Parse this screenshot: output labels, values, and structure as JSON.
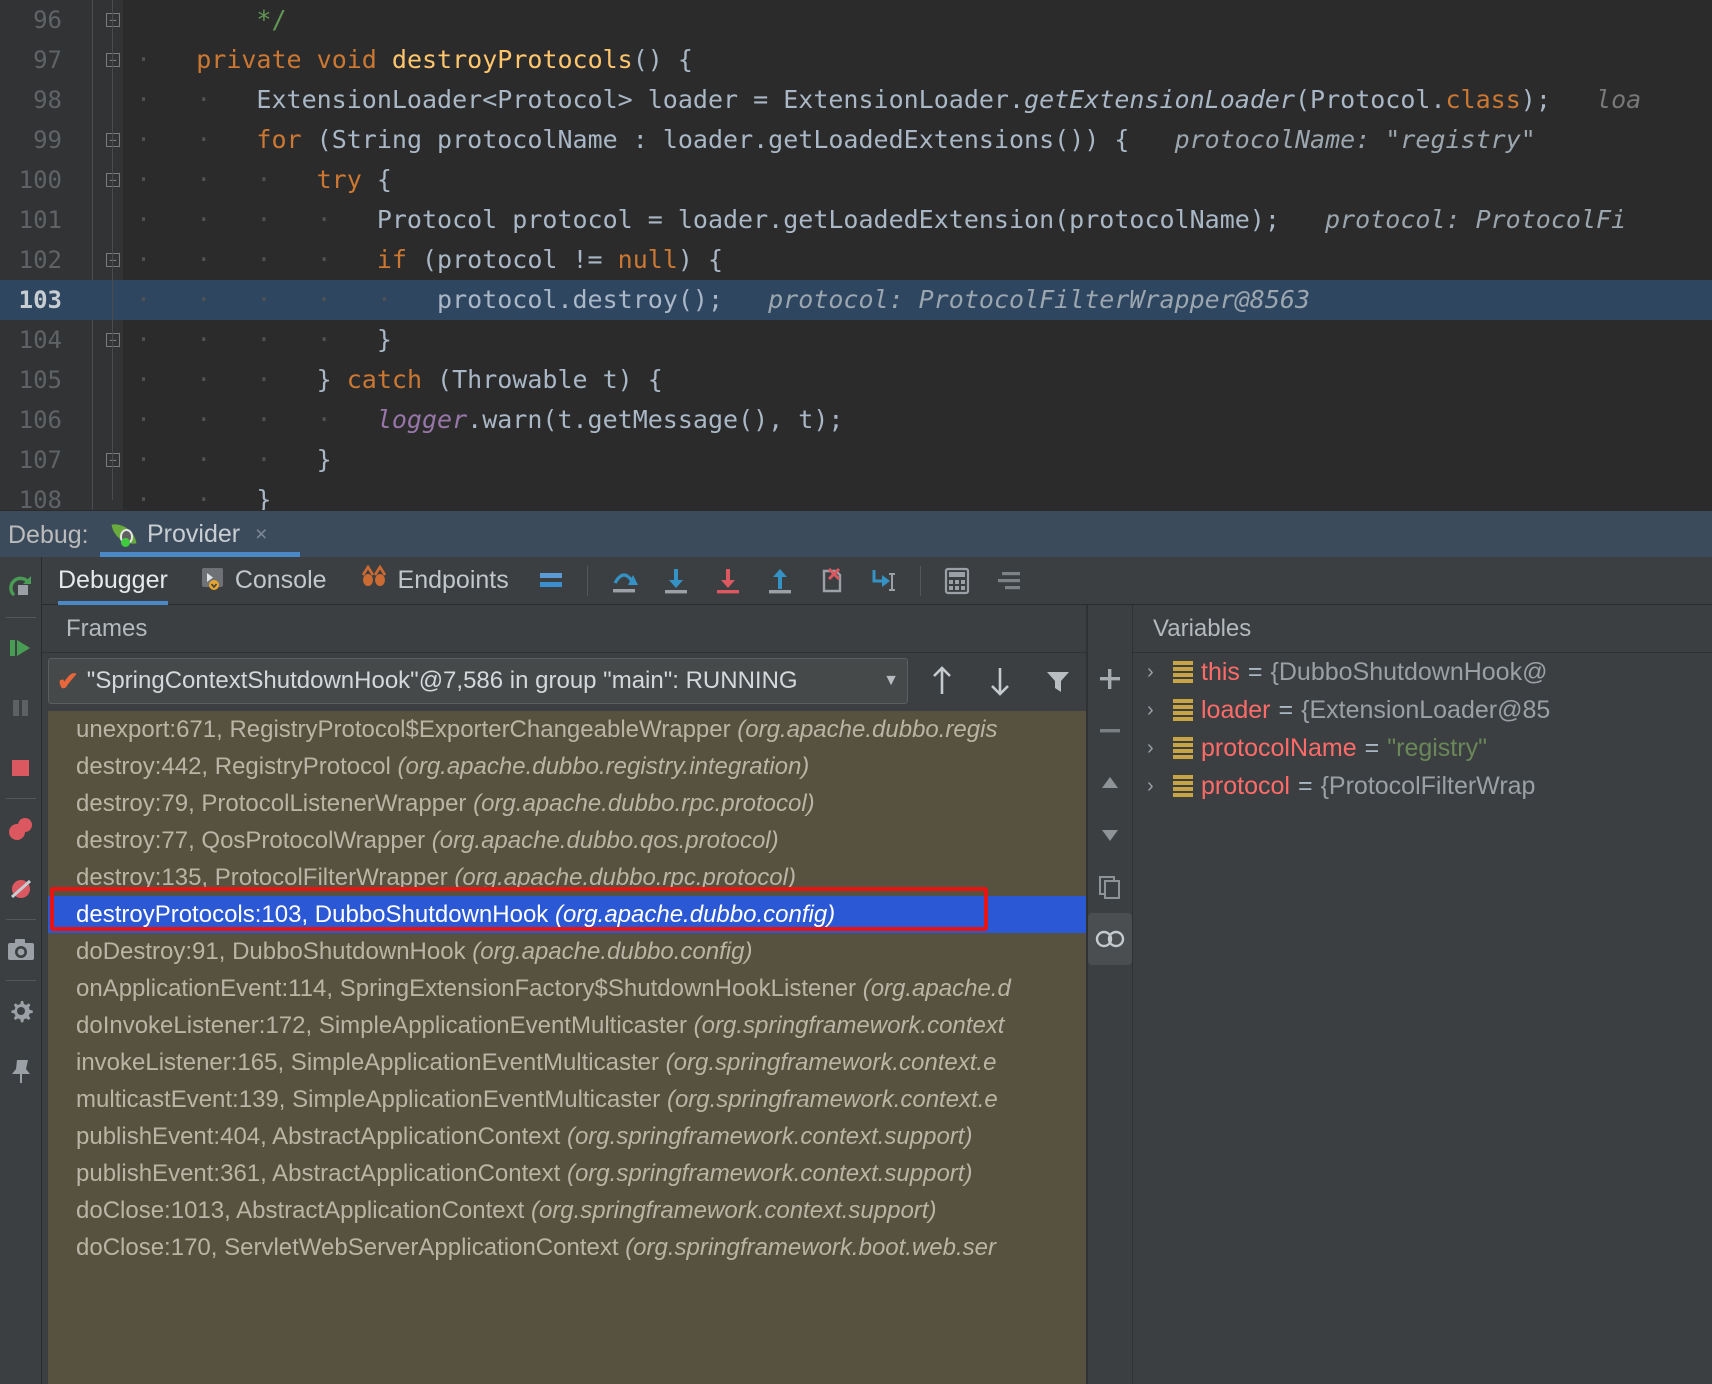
{
  "editor": {
    "lines": [
      {
        "num": "96",
        "segments": [
          {
            "t": "        */",
            "c": "cmt"
          }
        ]
      },
      {
        "num": "97",
        "segments": [
          {
            "t": "    ",
            "c": "dot"
          },
          {
            "t": "private ",
            "c": "kw"
          },
          {
            "t": "void ",
            "c": "kw"
          },
          {
            "t": "destroyProtocols",
            "c": "meth"
          },
          {
            "t": "() {",
            "c": "plain"
          }
        ]
      },
      {
        "num": "98",
        "segments": [
          {
            "t": "        ",
            "c": "dot"
          },
          {
            "t": "ExtensionLoader<Protocol> loader = ExtensionLoader.",
            "c": "plain"
          },
          {
            "t": "getExtensionLoader",
            "c": "ital"
          },
          {
            "t": "(Protocol.",
            "c": "plain"
          },
          {
            "t": "class",
            "c": "kw"
          },
          {
            "t": ");",
            "c": "plain"
          },
          {
            "t": "   loa",
            "c": "hint"
          }
        ]
      },
      {
        "num": "99",
        "segments": [
          {
            "t": "        ",
            "c": "dot"
          },
          {
            "t": "for ",
            "c": "kw"
          },
          {
            "t": "(String protocolName : loader.getLoadedExtensions()) {",
            "c": "plain"
          },
          {
            "t": "   protocolName: \"registry\"",
            "c": "hint2"
          }
        ]
      },
      {
        "num": "100",
        "segments": [
          {
            "t": "            ",
            "c": "dot"
          },
          {
            "t": "try ",
            "c": "kw"
          },
          {
            "t": "{",
            "c": "plain"
          }
        ]
      },
      {
        "num": "101",
        "segments": [
          {
            "t": "                ",
            "c": "dot"
          },
          {
            "t": "Protocol protocol = loader.getLoadedExtension(protocolName);",
            "c": "plain"
          },
          {
            "t": "   protocol: ProtocolFi",
            "c": "hint2"
          }
        ]
      },
      {
        "num": "102",
        "segments": [
          {
            "t": "                ",
            "c": "dot"
          },
          {
            "t": "if ",
            "c": "kw"
          },
          {
            "t": "(protocol != ",
            "c": "plain"
          },
          {
            "t": "null",
            "c": "kw"
          },
          {
            "t": ") {",
            "c": "plain"
          }
        ]
      },
      {
        "num": "103",
        "current": true,
        "segments": [
          {
            "t": "                    ",
            "c": "dot"
          },
          {
            "t": "protocol.destroy();",
            "c": "plain"
          },
          {
            "t": "   protocol: ProtocolFilterWrapper@8563",
            "c": "hint2"
          }
        ]
      },
      {
        "num": "104",
        "segments": [
          {
            "t": "                ",
            "c": "dot"
          },
          {
            "t": "}",
            "c": "plain"
          }
        ]
      },
      {
        "num": "105",
        "segments": [
          {
            "t": "            ",
            "c": "dot"
          },
          {
            "t": "} ",
            "c": "plain"
          },
          {
            "t": "catch ",
            "c": "kw"
          },
          {
            "t": "(Throwable t) {",
            "c": "plain"
          }
        ]
      },
      {
        "num": "106",
        "segments": [
          {
            "t": "                ",
            "c": "dot"
          },
          {
            "t": "logger",
            "c": "fld"
          },
          {
            "t": ".warn(t.getMessage(), t);",
            "c": "plain"
          }
        ]
      },
      {
        "num": "107",
        "segments": [
          {
            "t": "            ",
            "c": "dot"
          },
          {
            "t": "}",
            "c": "plain"
          }
        ]
      },
      {
        "num": "108",
        "segments": [
          {
            "t": "        ",
            "c": "dot"
          },
          {
            "t": "}",
            "c": "plain"
          }
        ]
      }
    ]
  },
  "debug_header": {
    "label": "Debug:",
    "tab_name": "Provider",
    "close_glyph": "×",
    "tab_icon": "spring-boot-icon"
  },
  "rail": {
    "buttons": [
      {
        "name": "rerun-button",
        "title": "Rerun"
      },
      {
        "name": "resume-program-button",
        "title": "Resume Program"
      },
      {
        "name": "pause-program-button",
        "title": "Pause Program"
      },
      {
        "name": "stop-button",
        "title": "Stop"
      },
      {
        "name": "view-breakpoints-button",
        "title": "View Breakpoints"
      },
      {
        "name": "mute-breakpoints-button",
        "title": "Mute Breakpoints"
      },
      {
        "name": "screenshot-button",
        "title": "Screenshot"
      },
      {
        "name": "settings-gear-button",
        "title": "Settings"
      },
      {
        "name": "pin-tab-button",
        "title": "Pin Tab"
      }
    ]
  },
  "toolbar": {
    "tabs": [
      {
        "label": "Debugger",
        "icon": "none",
        "active": true
      },
      {
        "label": "Console",
        "icon": "console-icon",
        "active": false
      },
      {
        "label": "Endpoints",
        "icon": "endpoints-icon",
        "active": false
      }
    ],
    "icons": [
      {
        "name": "layout-settings-icon"
      },
      {
        "name": "step-over-icon"
      },
      {
        "name": "step-into-icon"
      },
      {
        "name": "force-step-into-icon"
      },
      {
        "name": "step-out-icon"
      },
      {
        "name": "drop-frame-icon"
      },
      {
        "name": "run-to-cursor-icon"
      },
      {
        "name": "evaluate-expression-icon"
      },
      {
        "name": "settings-list-icon"
      }
    ]
  },
  "frames": {
    "panel_title": "Frames",
    "thread": {
      "text": "\"SpringContextShutdownHook\"@7,586 in group \"main\": RUNNING",
      "check_glyph": "✔",
      "caret_glyph": "▼"
    },
    "nav_buttons": [
      {
        "name": "frame-up-button",
        "glyph": "↑"
      },
      {
        "name": "frame-down-button",
        "glyph": "↓"
      },
      {
        "name": "filter-frames-button",
        "glyph": "filter-icon"
      }
    ],
    "rows": [
      {
        "method": "unexport:671, RegistryProtocol$ExporterChangeableWrapper",
        "pkg": "(org.apache.dubbo.regis"
      },
      {
        "method": "destroy:442, RegistryProtocol",
        "pkg": "(org.apache.dubbo.registry.integration)"
      },
      {
        "method": "destroy:79, ProtocolListenerWrapper",
        "pkg": "(org.apache.dubbo.rpc.protocol)"
      },
      {
        "method": "destroy:77, QosProtocolWrapper",
        "pkg": "(org.apache.dubbo.qos.protocol)"
      },
      {
        "method": "destroy:135, ProtocolFilterWrapper",
        "pkg": "(org.apache.dubbo.rpc.protocol)"
      },
      {
        "method": "destroyProtocols:103, DubboShutdownHook",
        "pkg": "(org.apache.dubbo.config)",
        "selected": true
      },
      {
        "method": "doDestroy:91, DubboShutdownHook",
        "pkg": "(org.apache.dubbo.config)"
      },
      {
        "method": "onApplicationEvent:114, SpringExtensionFactory$ShutdownHookListener",
        "pkg": "(org.apache.d"
      },
      {
        "method": "doInvokeListener:172, SimpleApplicationEventMulticaster",
        "pkg": "(org.springframework.context"
      },
      {
        "method": "invokeListener:165, SimpleApplicationEventMulticaster",
        "pkg": "(org.springframework.context.e"
      },
      {
        "method": "multicastEvent:139, SimpleApplicationEventMulticaster",
        "pkg": "(org.springframework.context.e"
      },
      {
        "method": "publishEvent:404, AbstractApplicationContext",
        "pkg": "(org.springframework.context.support)"
      },
      {
        "method": "publishEvent:361, AbstractApplicationContext",
        "pkg": "(org.springframework.context.support)"
      },
      {
        "method": "doClose:1013, AbstractApplicationContext",
        "pkg": "(org.springframework.context.support)"
      },
      {
        "method": "doClose:170, ServletWebServerApplicationContext",
        "pkg": "(org.springframework.boot.web.ser"
      }
    ]
  },
  "side_buttons": [
    {
      "name": "add-watch-button",
      "glyph": "+"
    },
    {
      "name": "remove-watch-button",
      "glyph": "−"
    },
    {
      "name": "move-watch-up-button",
      "glyph": "▲"
    },
    {
      "name": "move-watch-down-button",
      "glyph": "▼"
    },
    {
      "name": "copy-value-button",
      "glyph": "copy-icon"
    },
    {
      "name": "inspect-button",
      "glyph": "binoculars-icon"
    }
  ],
  "variables": {
    "panel_title": "Variables",
    "rows": [
      {
        "name": "this",
        "eq": "=",
        "value": "{DubboShutdownHook@",
        "is_string": false
      },
      {
        "name": "loader",
        "eq": "=",
        "value": "{ExtensionLoader@85",
        "is_string": false
      },
      {
        "name": "protocolName",
        "eq": "=",
        "value": "\"registry\"",
        "is_string": true
      },
      {
        "name": "protocol",
        "eq": "=",
        "value": "{ProtocolFilterWrap",
        "is_string": false
      }
    ]
  },
  "colors": {
    "editor_bg": "#2b2b2b",
    "panel_bg": "#3c3f41",
    "frames_bg": "#57513f",
    "selection_blue": "#2b58d4",
    "annotation_red": "#e81313",
    "accent_blue": "#4a88c7",
    "keyword_orange": "#cc7832",
    "method_yellow": "#ffc66d",
    "string_green": "#6a8759",
    "variable_coral": "#ff6b68"
  }
}
